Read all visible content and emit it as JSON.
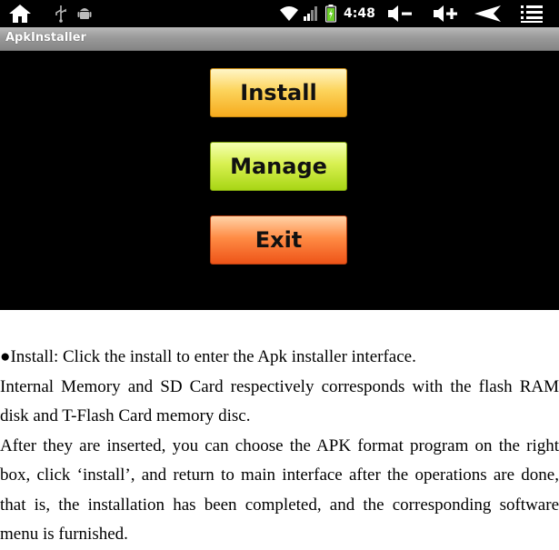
{
  "status_bar": {
    "time": "4:48",
    "left_icons": [
      "home-icon",
      "usb-icon",
      "android-debug-icon"
    ],
    "right_icons": [
      "wifi-icon",
      "signal-icon",
      "battery-icon",
      "volume-down-icon",
      "volume-up-icon",
      "back-icon",
      "menu-icon"
    ]
  },
  "app": {
    "title": "ApkInstaller",
    "buttons": {
      "install": "Install",
      "manage": "Manage",
      "exit": "Exit"
    }
  },
  "document": {
    "bullet_line": "●Install: Click the install to enter the Apk installer interface.",
    "paragraph_1": "Internal Memory and SD Card respectively corresponds with the flash RAM disk and T-Flash Card memory disc.",
    "paragraph_2": "After they are inserted, you can choose the APK format program on the right box, click ‘install’, and return to main interface after the operations are done, that is, the installation has been completed, and the corresponding software menu is furnished."
  },
  "colors": {
    "install_button": "#fcd45c",
    "manage_button": "#d8f050",
    "exit_button": "#ff8c45",
    "screen_background": "#000000",
    "title_bar": "#9a9a9a"
  }
}
